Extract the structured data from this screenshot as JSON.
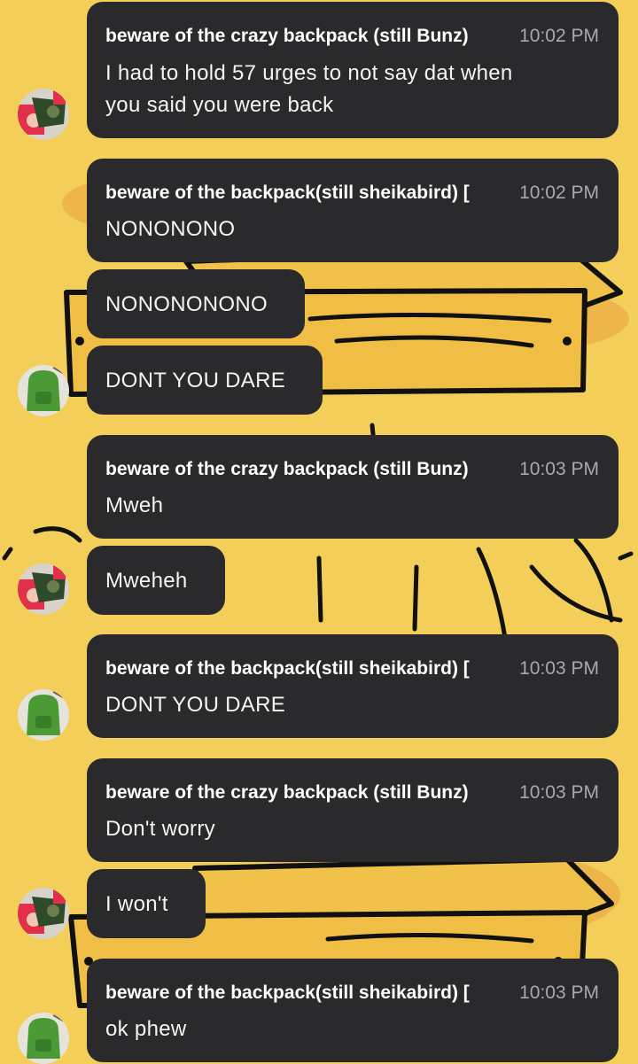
{
  "chat": {
    "messages": [
      {
        "author": "beware of the crazy backpack (still Bunz)",
        "time": "10:02 PM",
        "text": "I had to hold 57 urges to not say dat when\nyou said you were back"
      },
      {
        "author": "beware of the backpack(still sheikabird) [",
        "time": "10:02 PM",
        "text": "NONONONO"
      },
      {
        "text": "NONONONONO"
      },
      {
        "text": "DONT YOU DARE"
      },
      {
        "author": "beware of the crazy backpack (still Bunz)",
        "time": "10:03 PM",
        "text": "Mweh"
      },
      {
        "text": "Mweheh"
      },
      {
        "author": "beware of the backpack(still sheikabird) [",
        "time": "10:03 PM",
        "text": "DONT YOU DARE"
      },
      {
        "author": "beware of the crazy backpack (still Bunz)",
        "time": "10:03 PM",
        "text": "Don't worry"
      },
      {
        "text": "I won't"
      },
      {
        "author": "beware of the backpack(still sheikabird) [",
        "time": "10:03 PM",
        "text": "ok phew"
      }
    ]
  },
  "theme": {
    "bubble": "#2a2a2d",
    "background": "#f3cf5a",
    "timestamp": "#a9a9ad"
  }
}
